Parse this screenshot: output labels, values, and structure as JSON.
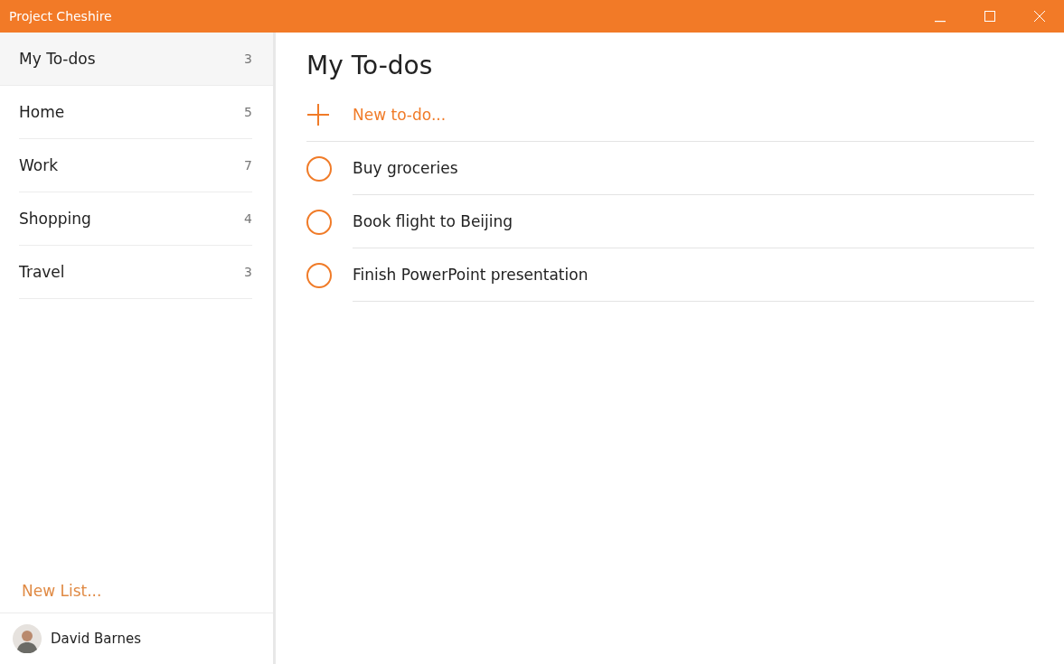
{
  "window": {
    "title": "Project Cheshire"
  },
  "sidebar": {
    "lists": [
      {
        "name": "My To-dos",
        "count": "3",
        "selected": true
      },
      {
        "name": "Home",
        "count": "5",
        "selected": false
      },
      {
        "name": "Work",
        "count": "7",
        "selected": false
      },
      {
        "name": "Shopping",
        "count": "4",
        "selected": false
      },
      {
        "name": "Travel",
        "count": "3",
        "selected": false
      }
    ],
    "new_list": "New List...",
    "user": {
      "name": "David Barnes"
    }
  },
  "main": {
    "heading": "My To-dos",
    "new_todo": "New to-do...",
    "todos": [
      {
        "text": "Buy groceries",
        "done": false
      },
      {
        "text": "Book flight to Beijing",
        "done": false
      },
      {
        "text": "Finish PowerPoint presentation",
        "done": false
      }
    ]
  }
}
